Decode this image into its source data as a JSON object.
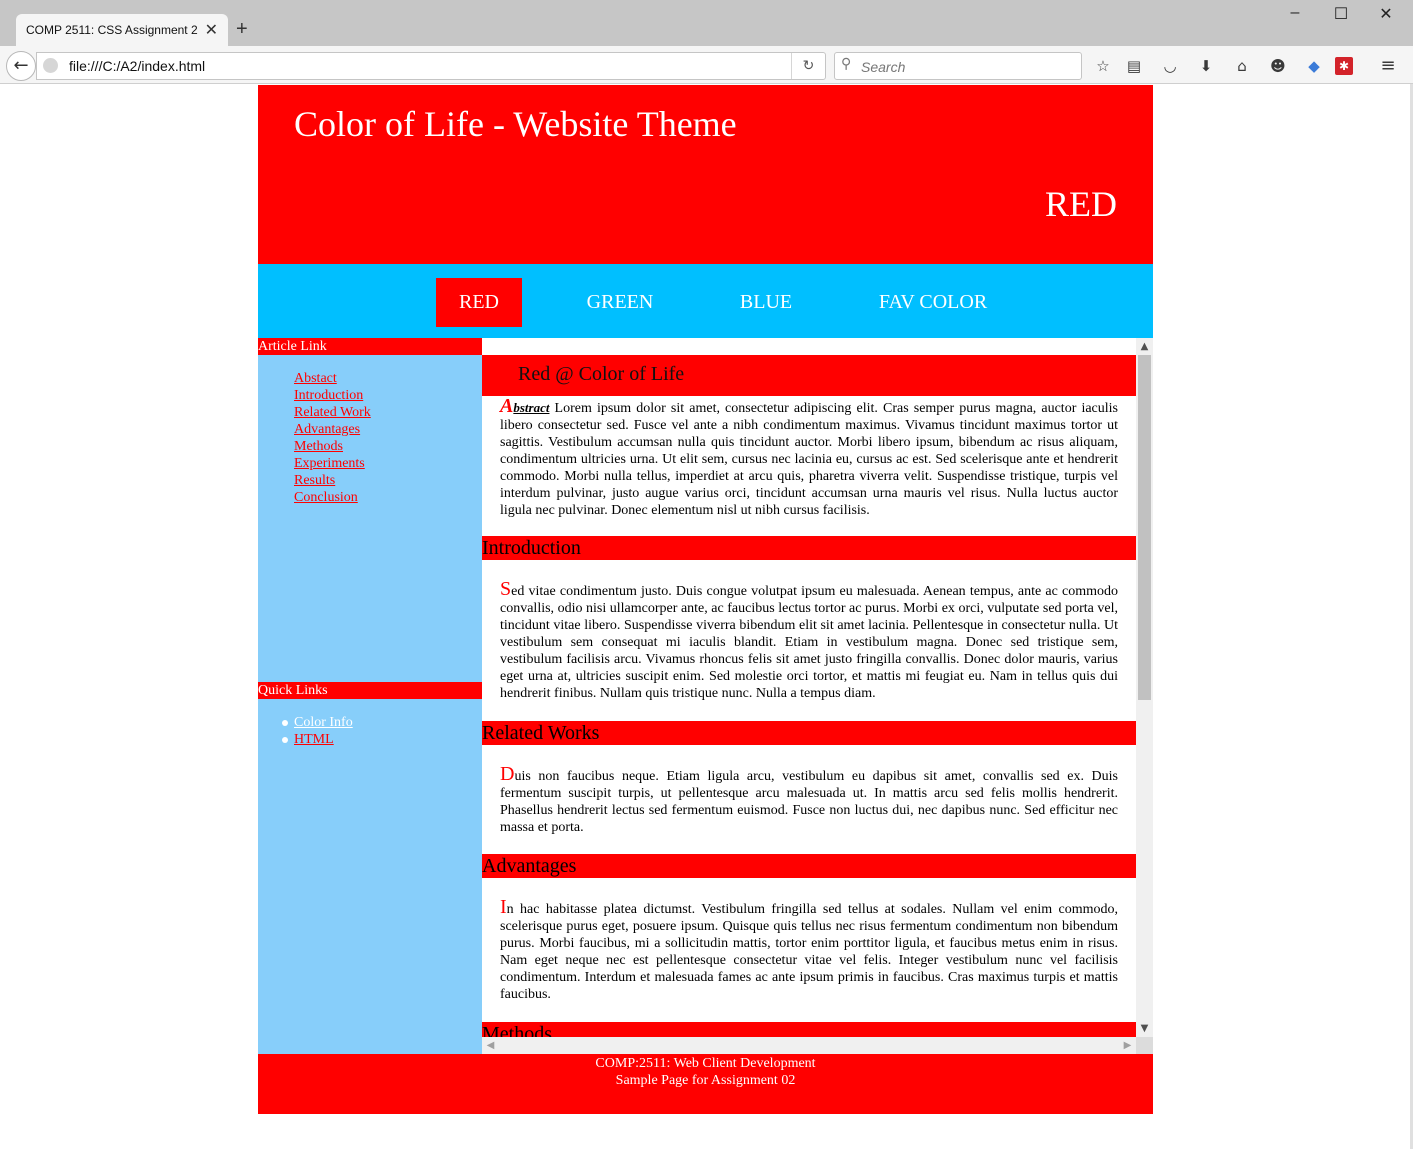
{
  "browser": {
    "tab_title": "COMP 2511: CSS Assignment 2",
    "url": "file:///C:/A2/index.html",
    "search_placeholder": "Search",
    "window_controls": {
      "minimize": "–",
      "maximize": "☐",
      "close": "✕"
    }
  },
  "header": {
    "title": "Color of Life - Website Theme",
    "theme": "RED"
  },
  "topnav": {
    "items": [
      {
        "label": "RED",
        "active": true
      },
      {
        "label": "GREEN",
        "active": false
      },
      {
        "label": "BLUE",
        "active": false
      },
      {
        "label": "FAV COLOR",
        "active": false
      }
    ]
  },
  "sidebar": {
    "article_heading": "Article Link",
    "article_links": [
      "Abstact",
      "Introduction",
      "Related Work",
      "Advantages",
      "Methods",
      "Experiments",
      "Results",
      "Conclusion"
    ],
    "quick_heading": "Quick Links",
    "quick_links": [
      "Color Info",
      "HTML"
    ]
  },
  "content": {
    "title": "Red @ Color of Life",
    "abstract_cap": "A",
    "abstract_label": "bstract",
    "abstract_text": " Lorem ipsum dolor sit amet, consectetur adipiscing elit. Cras semper purus magna, auctor iaculis libero consectetur sed. Fusce vel ante a nibh condimentum maximus. Vivamus tincidunt maximus tortor ut sagittis. Vestibulum accumsan nulla quis tincidunt auctor. Morbi libero ipsum, bibendum ac risus aliquam, condimentum ultricies urna. Ut elit sem, cursus nec lacinia eu, cursus ac est. Sed scelerisque ante et hendrerit commodo. Morbi nulla tellus, imperdiet at arcu quis, pharetra viverra velit. Suspendisse tristique, turpis vel interdum pulvinar, justo augue varius orci, tincidunt accumsan urna mauris vel risus. Nulla luctus auctor ligula nec pulvinar. Donec elementum nisl ut nibh cursus facilisis.",
    "sections": [
      {
        "heading": "Introduction",
        "cap": "S",
        "text": "ed vitae condimentum justo. Duis congue volutpat ipsum eu malesuada. Aenean tempus, ante ac commodo convallis, odio nisi ullamcorper ante, ac faucibus lectus tortor ac purus. Morbi ex orci, vulputate sed porta vel, tincidunt vitae libero. Suspendisse viverra bibendum elit sit amet lacinia. Pellentesque in consectetur nulla. Ut vestibulum sem consequat mi iaculis blandit. Etiam in vestibulum magna. Donec sed tristique sem, vestibulum facilisis arcu. Vivamus rhoncus felis sit amet justo fringilla convallis. Donec dolor mauris, varius eget urna at, ultricies suscipit enim. Sed molestie orci tortor, et mattis mi feugiat eu. Nam in tellus quis dui hendrerit finibus. Nullam quis tristique nunc. Nulla a tempus diam."
      },
      {
        "heading": "Related Works",
        "cap": "D",
        "text": "uis non faucibus neque. Etiam ligula arcu, vestibulum eu dapibus sit amet, convallis sed ex. Duis fermentum suscipit turpis, ut pellentesque arcu malesuada ut. In mattis arcu sed felis mollis hendrerit. Phasellus hendrerit lectus sed fermentum euismod. Fusce non luctus dui, nec dapibus nunc. Sed efficitur nec massa et porta."
      },
      {
        "heading": "Advantages",
        "cap": "I",
        "text": "n hac habitasse platea dictumst. Vestibulum fringilla sed tellus at sodales. Nullam vel enim commodo, scelerisque purus eget, posuere ipsum. Quisque quis tellus nec risus fermentum condimentum non bibendum purus. Morbi faucibus, mi a sollicitudin mattis, tortor enim porttitor ligula, et faucibus metus enim in risus. Nam eget neque nec est pellentesque consectetur vitae vel felis. Integer vestibulum nunc vel facilisis condimentum. Interdum et malesuada fames ac ante ipsum primis in faucibus. Cras maximus turpis et mattis faucibus."
      },
      {
        "heading": "Methods"
      }
    ]
  },
  "footer": {
    "line1": "COMP:2511: Web Client Development",
    "line2": "Sample Page for Assignment 02"
  },
  "colors": {
    "theme_red": "#ff0000",
    "nav_blue": "#00bfff",
    "sidebar_blue": "#87cefa"
  }
}
